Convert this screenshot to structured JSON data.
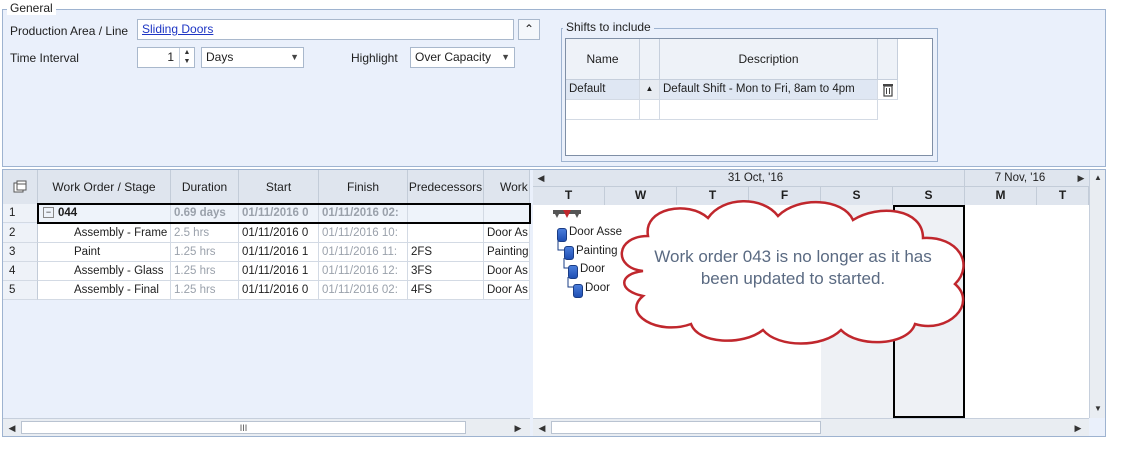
{
  "general": {
    "legend": "General",
    "production_area_label": "Production Area / Line",
    "production_area_value": "Sliding Doors",
    "collapse_glyph": "⌃",
    "time_interval_label": "Time Interval",
    "time_interval_value": "1",
    "interval_unit": "Days",
    "highlight_label": "Highlight",
    "highlight_value": "Over Capacity"
  },
  "shifts": {
    "title": "Shifts to include",
    "headers": [
      "Name",
      "Description"
    ],
    "rows": [
      {
        "name": "Default",
        "description": "Default Shift - Mon to Fri, 8am to 4pm"
      }
    ]
  },
  "grid": {
    "headers": [
      "Work Order / Stage",
      "Duration",
      "Start",
      "Finish",
      "Predecessors",
      "Work"
    ],
    "rows": [
      {
        "num": "1",
        "expander": "−",
        "stage": "044",
        "duration": "0.69 days",
        "start": "01/11/2016 0",
        "finish": "01/11/2016 02:",
        "pred": "",
        "work": ""
      },
      {
        "num": "2",
        "expander": "",
        "stage": "Assembly - Frame",
        "duration": "2.5 hrs",
        "start": "01/11/2016 0",
        "finish": "01/11/2016 10:",
        "pred": "",
        "work": "Door As"
      },
      {
        "num": "3",
        "expander": "",
        "stage": "Paint",
        "duration": "1.25 hrs",
        "start": "01/11/2016 1",
        "finish": "01/11/2016 11:",
        "pred": "2FS",
        "work": "Painting"
      },
      {
        "num": "4",
        "expander": "",
        "stage": "Assembly - Glass",
        "duration": "1.25 hrs",
        "start": "01/11/2016 1",
        "finish": "01/11/2016 12:",
        "pred": "3FS",
        "work": "Door As"
      },
      {
        "num": "5",
        "expander": "",
        "stage": "Assembly - Final",
        "duration": "1.25 hrs",
        "start": "01/11/2016 0",
        "finish": "01/11/2016 02:",
        "pred": "4FS",
        "work": "Door As"
      }
    ]
  },
  "gantt": {
    "week1": "31 Oct, '16",
    "week2": "7 Nov, '16",
    "days": [
      "T",
      "W",
      "T",
      "F",
      "S",
      "S",
      "M",
      "T"
    ],
    "tasks": [
      "Door Asse",
      "Painting",
      "Door",
      "Door"
    ]
  },
  "scroll": {
    "thumb_glyph": "III"
  },
  "callout": {
    "text": "Work order 043 is no longer as it has been updated to started."
  },
  "colors": {
    "accent": "#1d35c4",
    "callout_border": "#c0272d",
    "panel_bg": "#eaf0fb"
  }
}
